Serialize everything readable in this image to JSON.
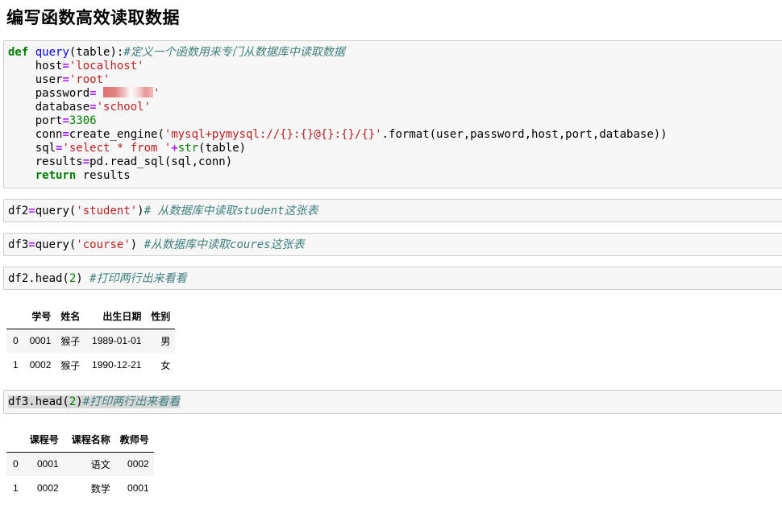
{
  "page_title": "编写函数高效读取数据",
  "cell1": {
    "comment": "#定义一个函数用来专门从数据库中读取数据",
    "host_val": "'localhost'",
    "user_val": "'root'",
    "db_val": "'school'",
    "port_val": "3306",
    "url_str": "'mysql+pymysql://{}:{}@{}:{}/{}'"
  },
  "cell2": {
    "arg": "'student'",
    "comment": "# 从数据库中读取student这张表"
  },
  "cell3": {
    "arg": "'course'",
    "comment": "#从数据库中读取coures这张表"
  },
  "cell4": {
    "arg": "2",
    "comment": "#打印两行出来看看"
  },
  "cell5": {
    "arg": "2",
    "comment": "#打印两行出来看看"
  },
  "table1": {
    "columns": [
      "",
      "学号",
      "姓名",
      "出生日期",
      "性别"
    ],
    "rows": [
      [
        "0",
        "0001",
        "猴子",
        "1989-01-01",
        "男"
      ],
      [
        "1",
        "0002",
        "猴子",
        "1990-12-21",
        "女"
      ]
    ]
  },
  "table2": {
    "columns": [
      "",
      "课程号",
      "课程名称",
      "教师号"
    ],
    "rows": [
      [
        "0",
        "0001",
        "语文",
        "0002"
      ],
      [
        "1",
        "0002",
        "数学",
        "0001"
      ]
    ]
  }
}
